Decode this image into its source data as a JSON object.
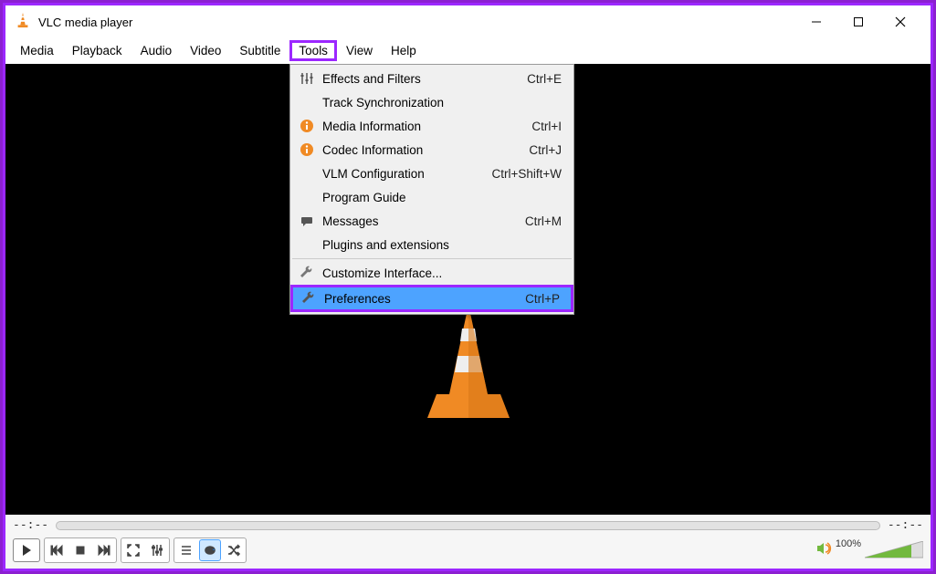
{
  "title": "VLC media player",
  "menubar": {
    "items": [
      "Media",
      "Playback",
      "Audio",
      "Video",
      "Subtitle",
      "Tools",
      "View",
      "Help"
    ],
    "active_index": 5
  },
  "dropdown": {
    "items": [
      {
        "icon": "sliders-icon",
        "label": "Effects and Filters",
        "shortcut": "Ctrl+E"
      },
      {
        "icon": "",
        "label": "Track Synchronization",
        "shortcut": ""
      },
      {
        "icon": "info-icon",
        "label": "Media Information",
        "shortcut": "Ctrl+I"
      },
      {
        "icon": "info-icon",
        "label": "Codec Information",
        "shortcut": "Ctrl+J"
      },
      {
        "icon": "",
        "label": "VLM Configuration",
        "shortcut": "Ctrl+Shift+W"
      },
      {
        "icon": "",
        "label": "Program Guide",
        "shortcut": ""
      },
      {
        "icon": "message-icon",
        "label": "Messages",
        "shortcut": "Ctrl+M"
      },
      {
        "icon": "",
        "label": "Plugins and extensions",
        "shortcut": ""
      },
      {
        "sep": true
      },
      {
        "icon": "wrench-icon",
        "label": "Customize Interface...",
        "shortcut": ""
      },
      {
        "icon": "wrench-icon",
        "label": "Preferences",
        "shortcut": "Ctrl+P",
        "highlight": true
      }
    ]
  },
  "seek": {
    "current": "--:--",
    "remaining": "--:--"
  },
  "volume": {
    "percent": "100%"
  },
  "controls": {
    "play": "Play",
    "prev": "Previous",
    "stop": "Stop",
    "next": "Next",
    "fullscreen": "Fullscreen",
    "effects": "Effects",
    "playlist": "Playlist",
    "loop": "Loop",
    "shuffle": "Shuffle"
  },
  "colors": {
    "accent": "#9c27ff",
    "highlight": "#4da3ff",
    "cone": "#f08a24"
  }
}
